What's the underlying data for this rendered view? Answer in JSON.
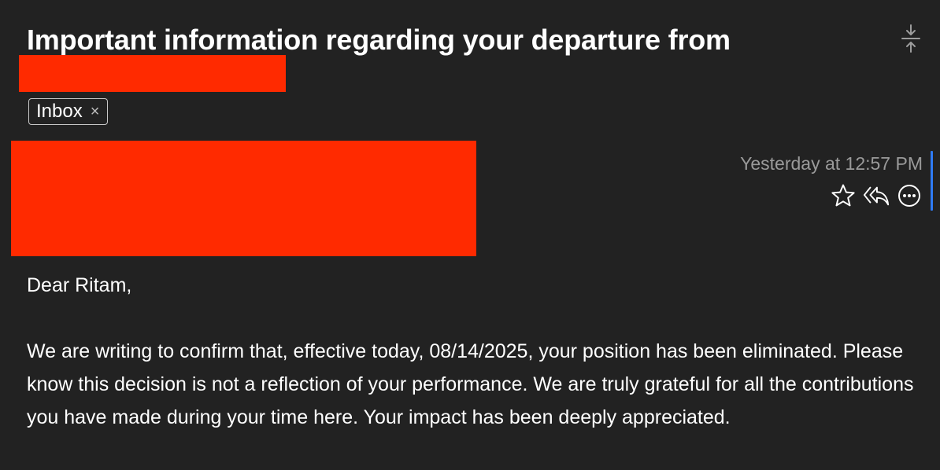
{
  "message": {
    "subject": "Important information regarding your departure from",
    "tag_label": "Inbox",
    "tag_close_glyph": "×",
    "timestamp": "Yesterday at 12:57 PM",
    "greeting": "Dear Ritam,",
    "body_paragraph": "We are writing to confirm that, effective today, 08/14/2025, your position has been eliminated. Please know this decision is not a reflection of your performance. We are truly grateful for all the contributions you have made during your time here. Your impact has been deeply appreciated."
  },
  "icons": {
    "collapse": "collapse-icon",
    "star": "star-icon",
    "reply_all": "reply-all-icon",
    "more": "more-icon"
  },
  "colors": {
    "background": "#222222",
    "text": "#ffffff",
    "muted_text": "#9a9a9a",
    "redaction": "#ff2a00",
    "focus_accent": "#2f7bf5"
  }
}
